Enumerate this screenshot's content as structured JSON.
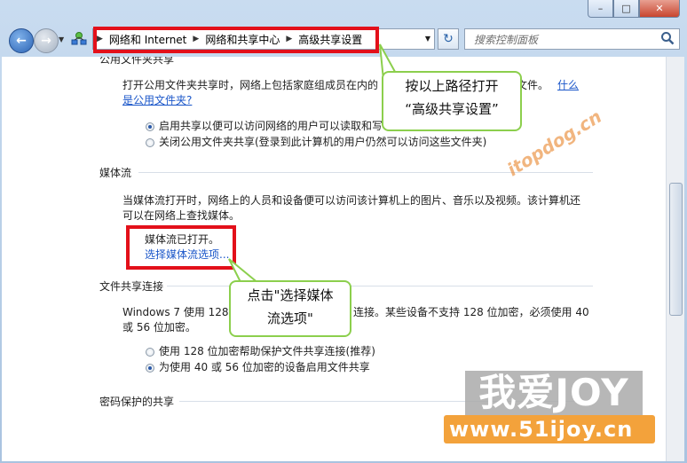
{
  "window": {
    "minimize_glyph": "–",
    "maximize_glyph": "□",
    "close_glyph": "✕"
  },
  "address": {
    "crumbs": [
      "网络和 Internet",
      "网络和共享中心",
      "高级共享设置"
    ],
    "separator_glyph": "▶"
  },
  "search": {
    "placeholder": "搜索控制面板"
  },
  "public_folder": {
    "heading": "公用文件夹共享",
    "desc_line1_a": "打开公用文件夹共享时，网络上包括家庭组成员在内的",
    "desc_line1_b": "文件。",
    "link_1": "什么",
    "link_2": "是公用文件夹?",
    "option_on": "启用共享以便可以访问网络的用户可以读取和写",
    "option_off": "关闭公用文件夹共享(登录到此计算机的用户仍然可以访问这些文件夹)"
  },
  "media_streaming": {
    "heading": "媒体流",
    "desc_line1": "当媒体流打开时，网络上的人员和设备便可以访问该计算机上的图片、音乐以及视频。该计算机还",
    "desc_line2": "可以在网络上查找媒体。",
    "status": "媒体流已打开。",
    "link": "选择媒体流选项..."
  },
  "file_sharing": {
    "heading": "文件共享连接",
    "desc_line1_a": "Windows 7 使用 128",
    "desc_line1_b": "连接。某些设备不支持 128 位加密，必须使用 40",
    "desc_line2": "或 56 位加密。",
    "option_128": "使用 128 位加密帮助保护文件共享连接(推荐)",
    "option_40_56": "为使用 40 或 56 位加密的设备启用文件共享"
  },
  "password": {
    "heading": "密码保护的共享"
  },
  "annotations": {
    "callout_path_line1": "按以上路径打开",
    "callout_path_line2": "“高级共享设置”",
    "callout_media_line1": "点击\"选择媒体",
    "callout_media_line2": "流选项\""
  },
  "watermarks": {
    "itopdog_cn": "itopdog.cn",
    "joy": "我爱JOY",
    "site": "www.51ijoy.cn"
  },
  "colors": {
    "annotation_red": "#e3101a",
    "callout_border": "#8ccf4d",
    "link": "#1a56c9"
  }
}
